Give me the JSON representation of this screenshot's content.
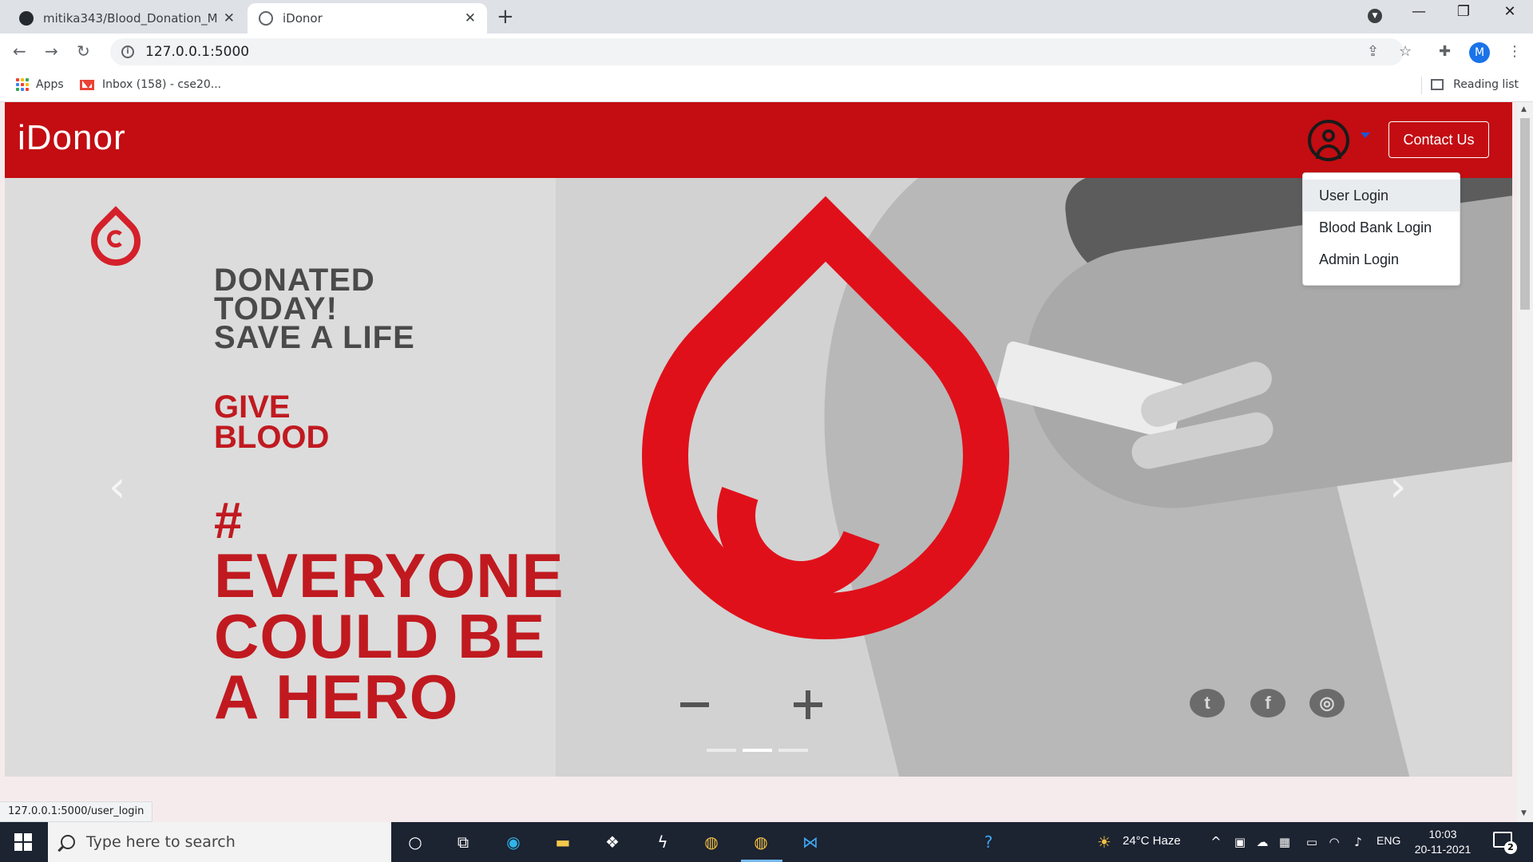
{
  "browser": {
    "tabs": [
      {
        "title": "mitika343/Blood_Donation_Mana",
        "active": false
      },
      {
        "title": "iDonor",
        "active": true
      }
    ],
    "url": "127.0.0.1:5000",
    "bookmarks": {
      "apps_label": "Apps",
      "gmail_label": "Inbox (158) - cse20...",
      "reading_list_label": "Reading list"
    },
    "profile_initial": "M"
  },
  "site": {
    "brand": "iDonor",
    "contact_label": "Contact Us",
    "dropdown": [
      {
        "label": "User Login",
        "highlighted": true
      },
      {
        "label": "Blood Bank Login",
        "highlighted": false
      },
      {
        "label": "Admin Login",
        "highlighted": false
      }
    ],
    "carousel": {
      "headline": [
        "DONATED",
        "TODAY!",
        "SAVE A LIFE"
      ],
      "give": [
        "GIVE",
        "BLOOD"
      ],
      "hashtag": "#",
      "hero": [
        "EVERYONE",
        "COULD BE",
        "A HERO"
      ],
      "prev_symbol": "‹",
      "next_symbol": "›",
      "active_slide": 2,
      "slide_count": 3
    },
    "colors": {
      "brand_red": "#c30d12",
      "accent_red": "#e0101a"
    }
  },
  "status_bar_url": "127.0.0.1:5000/user_login",
  "taskbar": {
    "search_placeholder": "Type here to search",
    "weather": "24°C  Haze",
    "language": "ENG",
    "time": "10:03",
    "date": "20-11-2021",
    "notification_count": "2"
  }
}
